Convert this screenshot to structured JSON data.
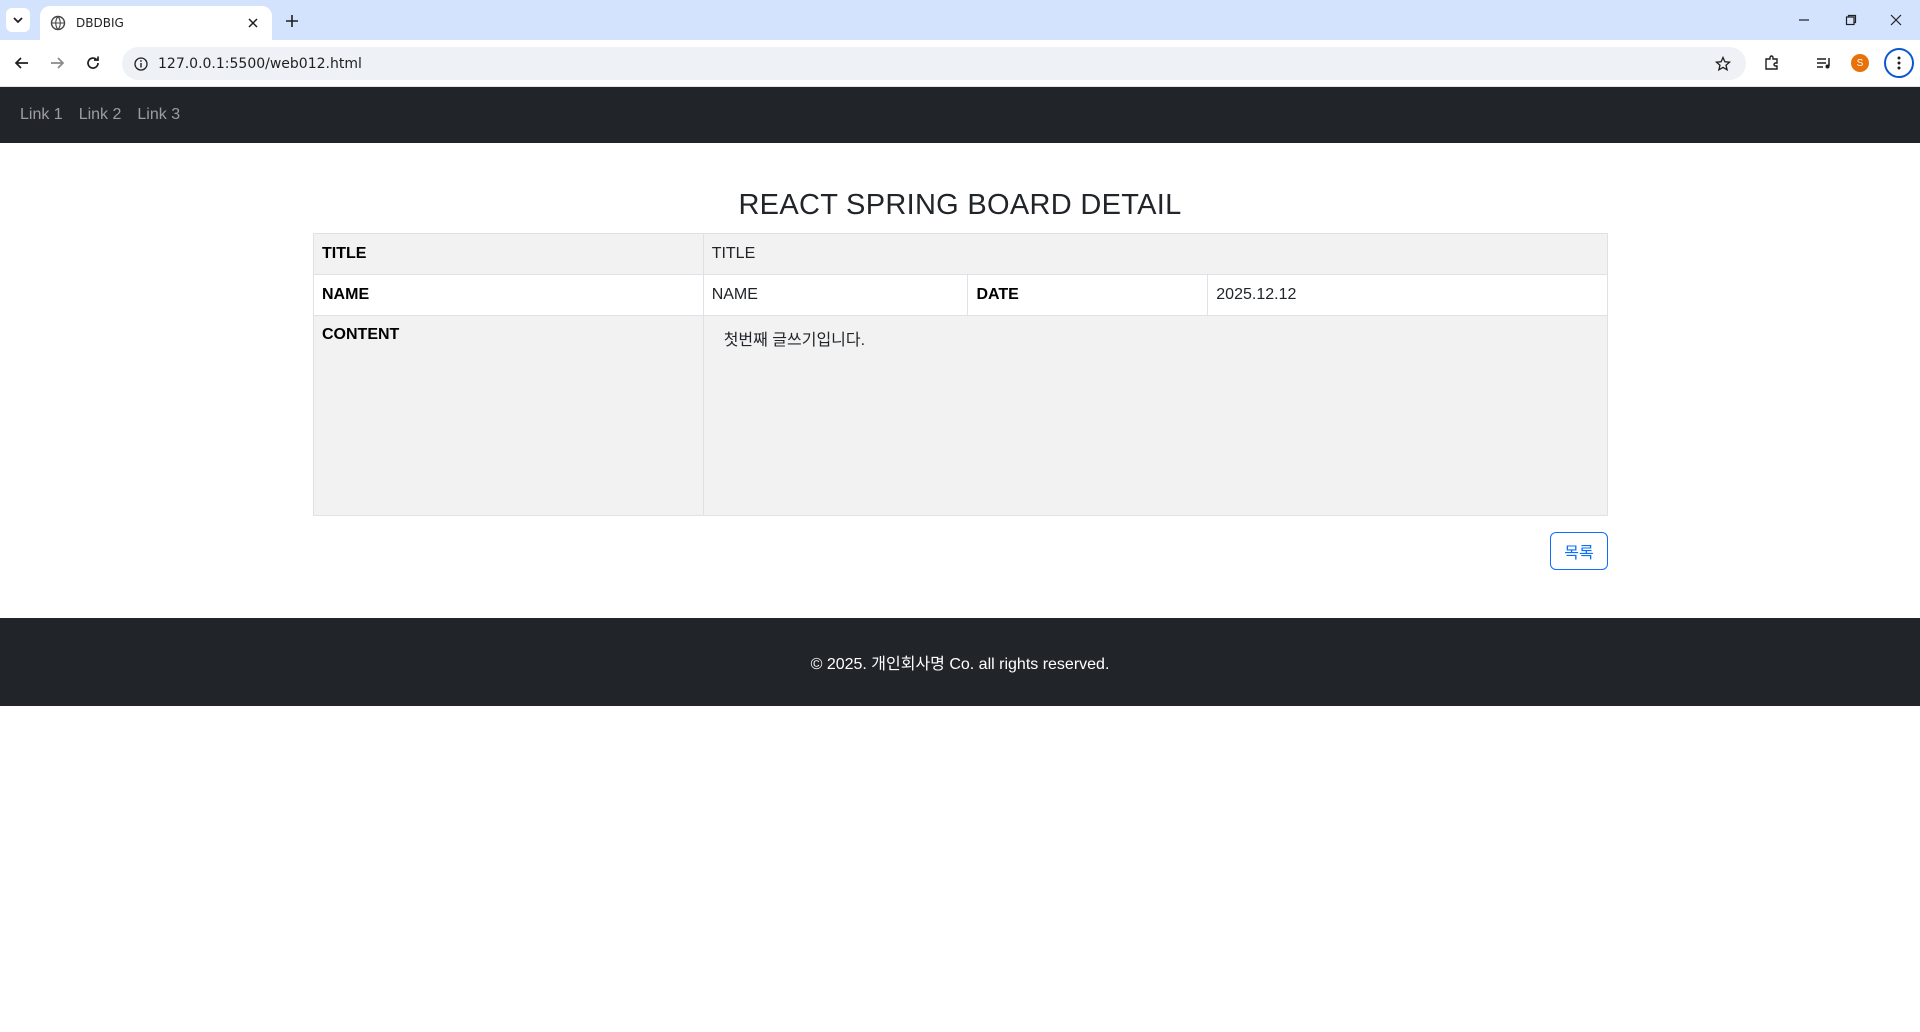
{
  "browser": {
    "tab_title": "DBDBIG",
    "url": "127.0.0.1:5500/web012.html",
    "profile_initial": "S"
  },
  "nav": {
    "links": [
      "Link 1",
      "Link 2",
      "Link 3"
    ]
  },
  "board": {
    "heading": "REACT SPRING BOARD DETAIL",
    "title_label": "TITLE",
    "title_value": "TITLE",
    "name_label": "NAME",
    "name_value": "NAME",
    "date_label": "DATE",
    "date_value": "2025.12.12",
    "content_label": "CONTENT",
    "content_value": "첫번째 글쓰기입니다.",
    "list_button": "목록"
  },
  "footer": {
    "text": "© 2025. 개인회사명 Co. all rights reserved."
  },
  "colors": {
    "navbar": "#212529",
    "footer": "#212529",
    "tabstrip": "#d3e3fd",
    "button_accent": "#0d6efd"
  }
}
